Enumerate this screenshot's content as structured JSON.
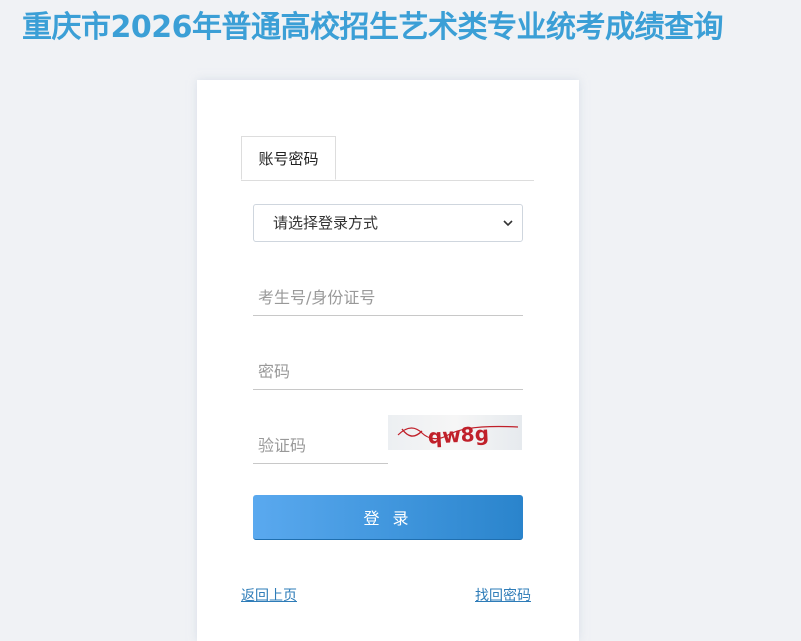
{
  "header": {
    "title": "重庆市2026年普通高校招生艺术类专业统考成绩查询"
  },
  "login": {
    "tab_label": "账号密码",
    "login_method": {
      "selected": "请选择登录方式"
    },
    "id_field": {
      "placeholder": "考生号/身份证号",
      "value": ""
    },
    "password_field": {
      "placeholder": "密码",
      "value": ""
    },
    "captcha_field": {
      "placeholder": "验证码",
      "value": ""
    },
    "captcha_text": "qw8g",
    "submit_label": "登 录",
    "back_link": "返回上页",
    "forgot_link": "找回密码"
  },
  "colors": {
    "title": "#3b9fd6",
    "button_start": "#5aa9ef",
    "button_end": "#2a84cc",
    "link": "#2e7cb8",
    "captcha_ink": "#c0202a"
  }
}
